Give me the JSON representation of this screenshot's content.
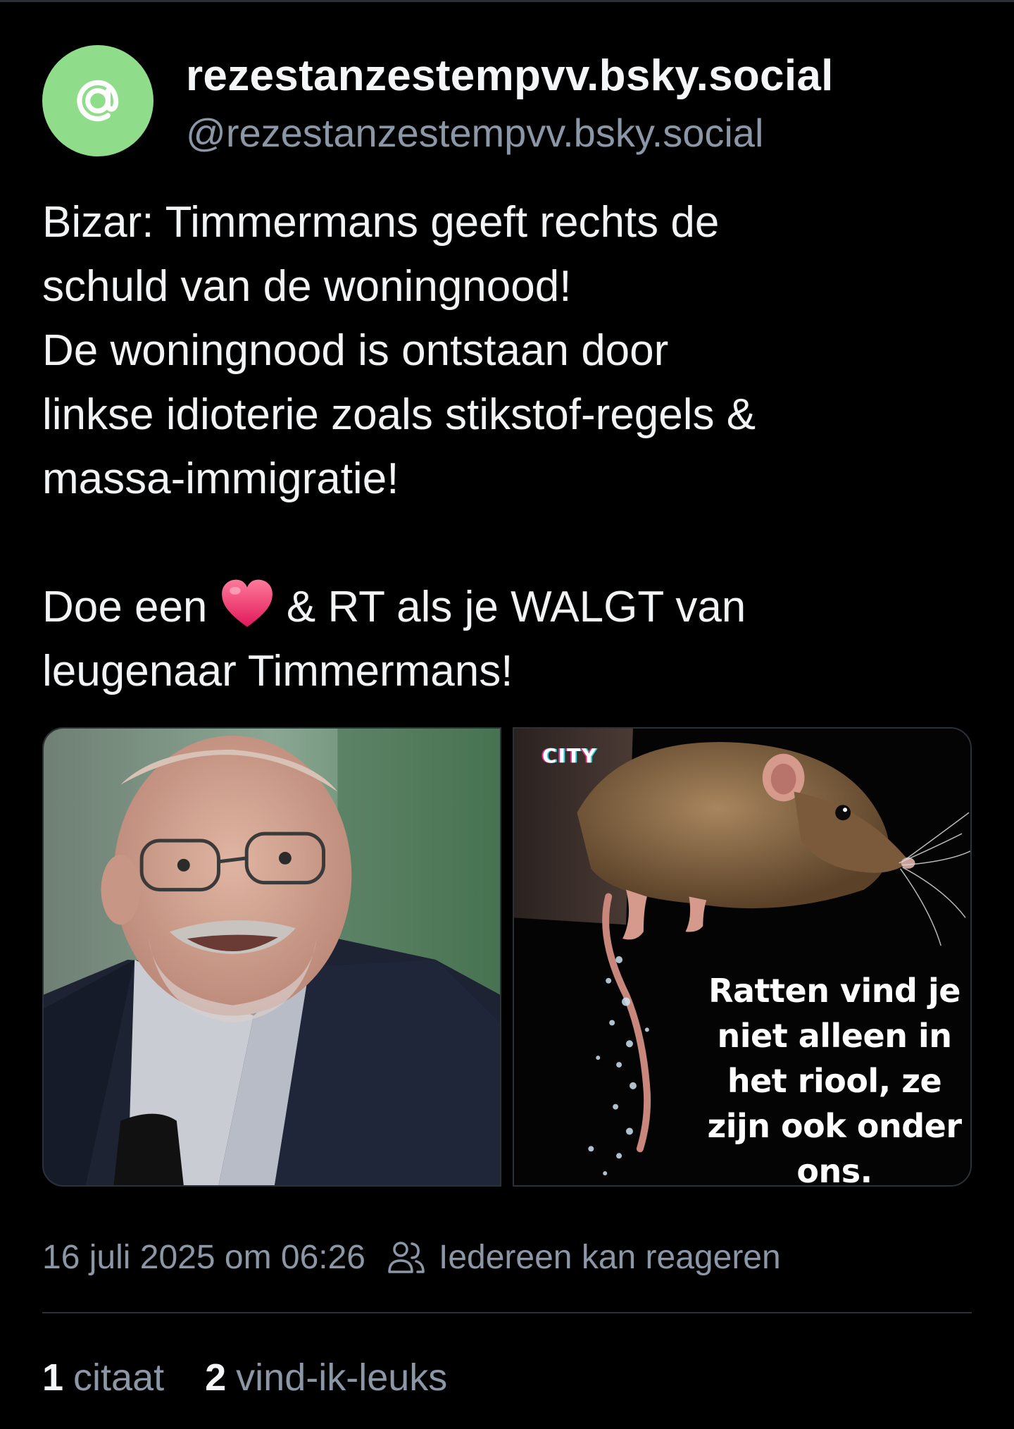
{
  "author": {
    "display_name": "rezestanzestempvv.bsky.social",
    "handle": "@rezestanzestempvv.bsky.social",
    "avatar_icon": "at-sign-icon",
    "avatar_color": "#8fdc8a"
  },
  "post": {
    "lines": [
      "Bizar: Timmermans geeft rechts de",
      "schuld van de woningnood!",
      "De woningnood is ontstaan door",
      "linkse idioterie zoals stikstof-regels &",
      "massa-immigratie!"
    ],
    "cta_prefix": "Doe een",
    "cta_suffix": "& RT als je WALGT van",
    "cta_last_line": "leugenaar Timmermans!",
    "emoji_icon": "heart-icon"
  },
  "images": {
    "right": {
      "logo_text": "CITY",
      "caption_lines": [
        "Ratten vind je",
        "niet alleen in",
        "het riool, ze",
        "zijn ook onder",
        "ons."
      ]
    }
  },
  "meta": {
    "timestamp": "16 juli 2025 om 06:26",
    "reply_setting": "Iedereen kan reageren",
    "reply_icon": "people-icon"
  },
  "stats": {
    "quotes_count": "1",
    "quotes_label": "citaat",
    "likes_count": "2",
    "likes_label": "vind-ik-leuks"
  }
}
